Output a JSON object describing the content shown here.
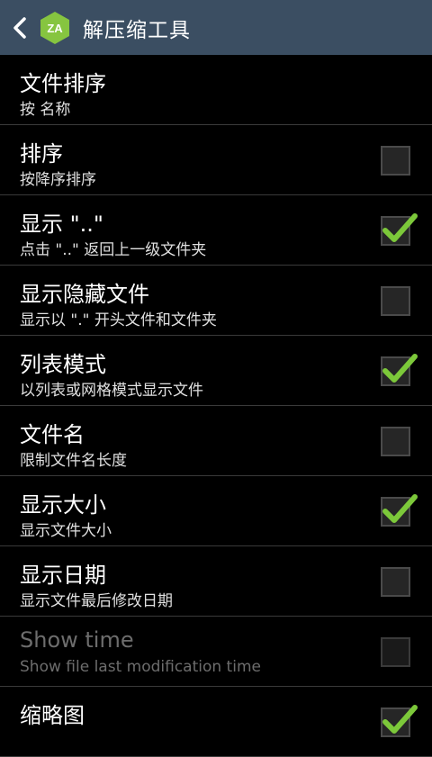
{
  "app": {
    "title": "解压缩工具",
    "logo_text": "ZA",
    "logo_color": "#86c540",
    "header_color": "#3b4e62"
  },
  "settings": [
    {
      "title": "文件排序",
      "subtitle": "按 名称",
      "checkbox": false,
      "checked": false,
      "enabled": true
    },
    {
      "title": "排序",
      "subtitle": "按降序排序",
      "checkbox": true,
      "checked": false,
      "enabled": true
    },
    {
      "title": "显示 \"..\"",
      "subtitle": "点击 \"..\" 返回上一级文件夹",
      "checkbox": true,
      "checked": true,
      "enabled": true
    },
    {
      "title": "显示隐藏文件",
      "subtitle": "显示以 \".\" 开头文件和文件夹",
      "checkbox": true,
      "checked": false,
      "enabled": true
    },
    {
      "title": "列表模式",
      "subtitle": "以列表或网格模式显示文件",
      "checkbox": true,
      "checked": true,
      "enabled": true
    },
    {
      "title": "文件名",
      "subtitle": "限制文件名长度",
      "checkbox": true,
      "checked": false,
      "enabled": true
    },
    {
      "title": "显示大小",
      "subtitle": "显示文件大小",
      "checkbox": true,
      "checked": true,
      "enabled": true
    },
    {
      "title": "显示日期",
      "subtitle": "显示文件最后修改日期",
      "checkbox": true,
      "checked": false,
      "enabled": true
    },
    {
      "title": "Show time",
      "subtitle": "Show file last modification time",
      "checkbox": true,
      "checked": false,
      "enabled": false
    },
    {
      "title": "缩略图",
      "subtitle": "",
      "checkbox": true,
      "checked": true,
      "enabled": true
    }
  ],
  "colors": {
    "check_green": "#7cc83a"
  }
}
